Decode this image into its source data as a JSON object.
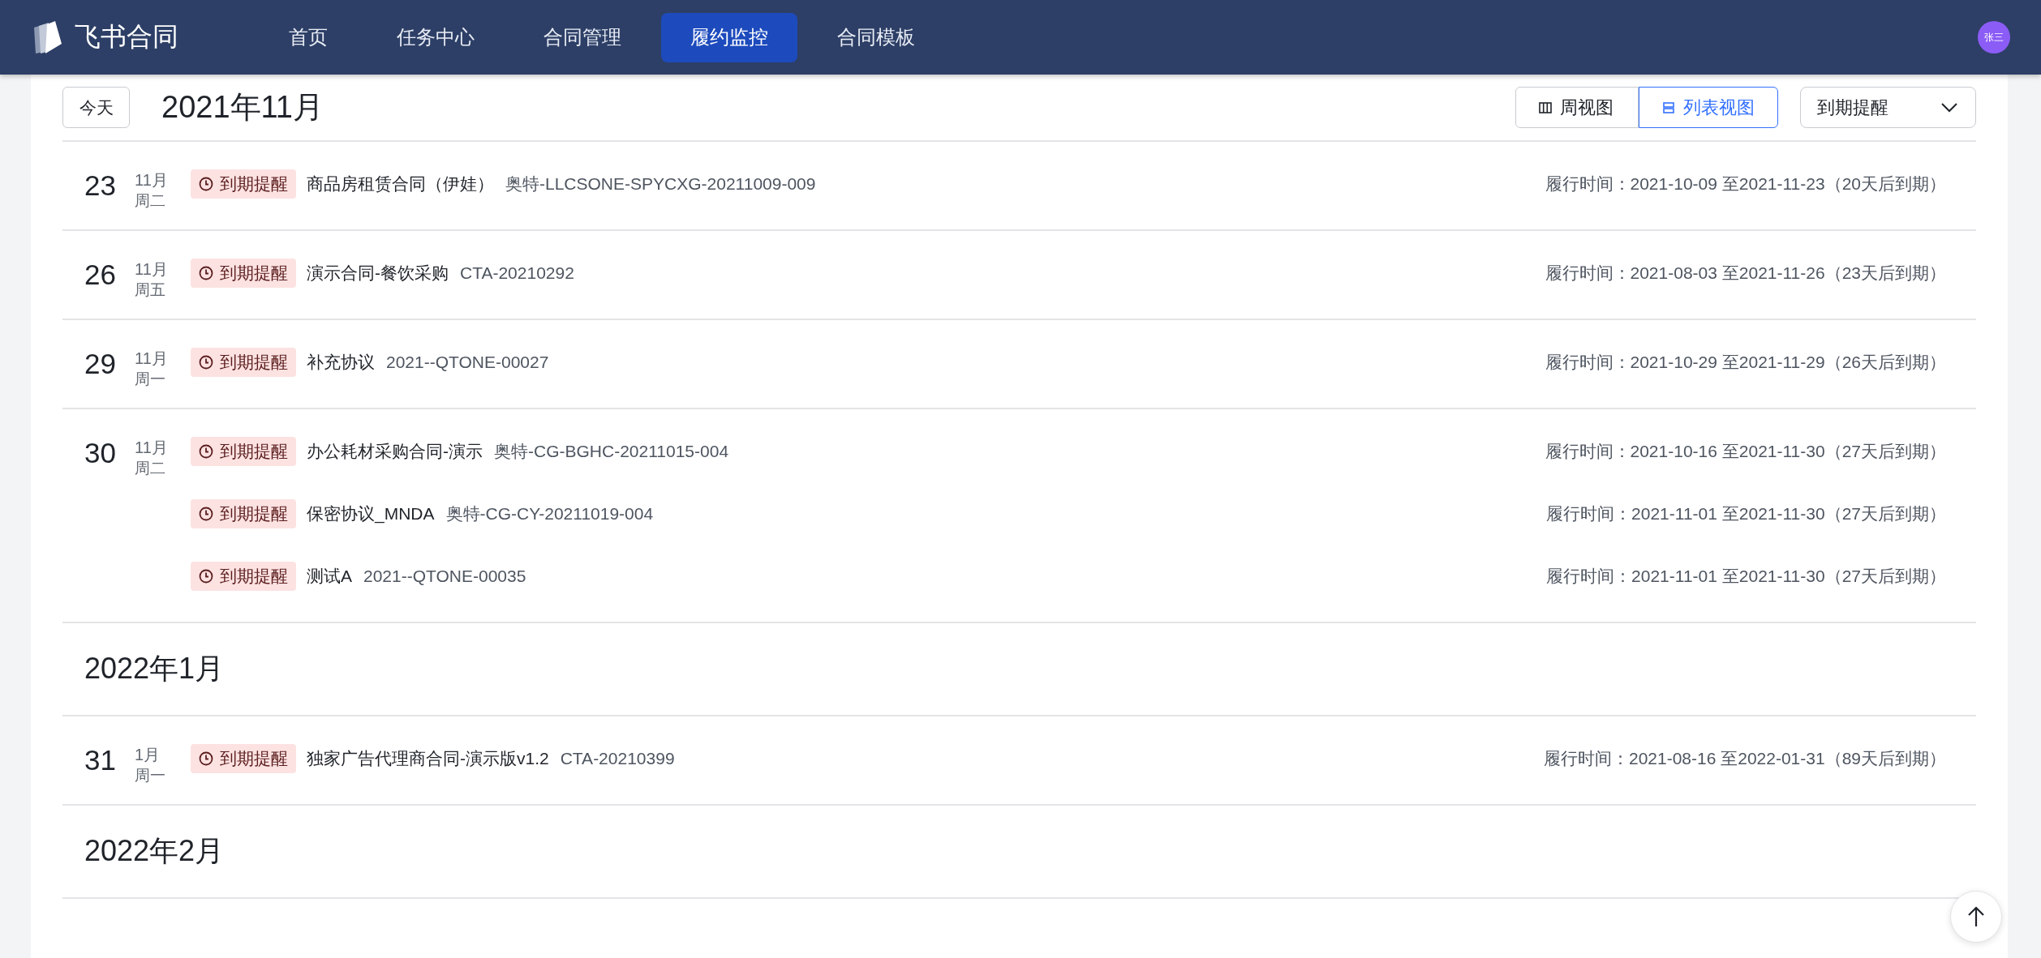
{
  "nav": {
    "logo": "飞书合同",
    "avatar": "张三",
    "items": [
      {
        "label": "首页",
        "selected": false
      },
      {
        "label": "任务中心",
        "selected": false
      },
      {
        "label": "合同管理",
        "selected": false
      },
      {
        "label": "履约监控",
        "selected": true
      },
      {
        "label": "合同模板",
        "selected": false
      }
    ]
  },
  "toolbar": {
    "today": "今天",
    "title": "2021年11月",
    "filter": "到期提醒",
    "views": [
      {
        "label": "周视图",
        "kind": "week",
        "selected": false
      },
      {
        "label": "列表视图",
        "kind": "list",
        "selected": true
      }
    ]
  },
  "entries": [
    {
      "kind": "day",
      "day": "23",
      "month": "11月",
      "weekday": "周二",
      "items": [
        {
          "tag": "到期提醒",
          "name": "商品房租赁合同（伊娃）",
          "code": "奥特-LLCSONE-SPYCXG-20211009-009",
          "period": "履行时间：2021-10-09 至2021-11-23（20天后到期）"
        }
      ]
    },
    {
      "kind": "day",
      "day": "26",
      "month": "11月",
      "weekday": "周五",
      "items": [
        {
          "tag": "到期提醒",
          "name": "演示合同-餐饮采购",
          "code": "CTA-20210292",
          "period": "履行时间：2021-08-03 至2021-11-26（23天后到期）"
        }
      ]
    },
    {
      "kind": "day",
      "day": "29",
      "month": "11月",
      "weekday": "周一",
      "items": [
        {
          "tag": "到期提醒",
          "name": "补充协议",
          "code": "2021--QTONE-00027",
          "period": "履行时间：2021-10-29 至2021-11-29（26天后到期）"
        }
      ]
    },
    {
      "kind": "day",
      "day": "30",
      "month": "11月",
      "weekday": "周二",
      "items": [
        {
          "tag": "到期提醒",
          "name": "办公耗材采购合同-演示",
          "code": "奥特-CG-BGHC-20211015-004",
          "period": "履行时间：2021-10-16 至2021-11-30（27天后到期）"
        },
        {
          "tag": "到期提醒",
          "name": "保密协议_MNDA",
          "code": "奥特-CG-CY-20211019-004",
          "period": "履行时间：2021-11-01 至2021-11-30（27天后到期）"
        },
        {
          "tag": "到期提醒",
          "name": "测试A",
          "code": "2021--QTONE-00035",
          "period": "履行时间：2021-11-01 至2021-11-30（27天后到期）"
        }
      ]
    },
    {
      "kind": "month",
      "title": "2022年1月"
    },
    {
      "kind": "day",
      "day": "31",
      "month": "1月",
      "weekday": "周一",
      "items": [
        {
          "tag": "到期提醒",
          "name": "独家广告代理商合同-演示版v1.2",
          "code": "CTA-20210399",
          "period": "履行时间：2021-08-16 至2022-01-31（89天后到期）"
        }
      ]
    },
    {
      "kind": "month",
      "title": "2022年2月"
    }
  ]
}
